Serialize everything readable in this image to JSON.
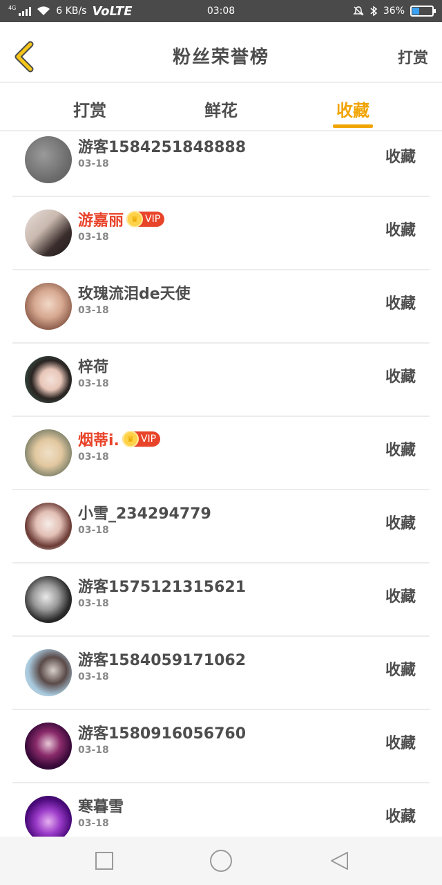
{
  "status_bar": {
    "network": "4G",
    "speed": "6 KB/s",
    "volte": "VoLTE",
    "time": "03:08",
    "battery": "36%",
    "battery_level": 0.36
  },
  "header": {
    "title": "粉丝荣誉榜",
    "action": "打赏"
  },
  "tabs": [
    {
      "label": "打赏",
      "active": false
    },
    {
      "label": "鲜花",
      "active": false
    },
    {
      "label": "收藏",
      "active": true
    }
  ],
  "colors": {
    "accent": "#f0a400",
    "vip": "#e8442a"
  },
  "vip_label": "VIP",
  "list": [
    {
      "name": "游客1584251848888",
      "date": "03-18",
      "action": "收藏",
      "vip": false
    },
    {
      "name": "游嘉丽",
      "date": "03-18",
      "action": "收藏",
      "vip": true
    },
    {
      "name": "玫瑰流泪de天使",
      "date": "03-18",
      "action": "收藏",
      "vip": false
    },
    {
      "name": "梓荷",
      "date": "03-18",
      "action": "收藏",
      "vip": false
    },
    {
      "name": "烟蒂i.",
      "date": "03-18",
      "action": "收藏",
      "vip": true
    },
    {
      "name": "小雪_234294779",
      "date": "03-18",
      "action": "收藏",
      "vip": false
    },
    {
      "name": "游客1575121315621",
      "date": "03-18",
      "action": "收藏",
      "vip": false
    },
    {
      "name": "游客1584059171062",
      "date": "03-18",
      "action": "收藏",
      "vip": false
    },
    {
      "name": "游客1580916056760",
      "date": "03-18",
      "action": "收藏",
      "vip": false
    },
    {
      "name": "寒暮雪",
      "date": "03-18",
      "action": "收藏",
      "vip": false
    }
  ]
}
